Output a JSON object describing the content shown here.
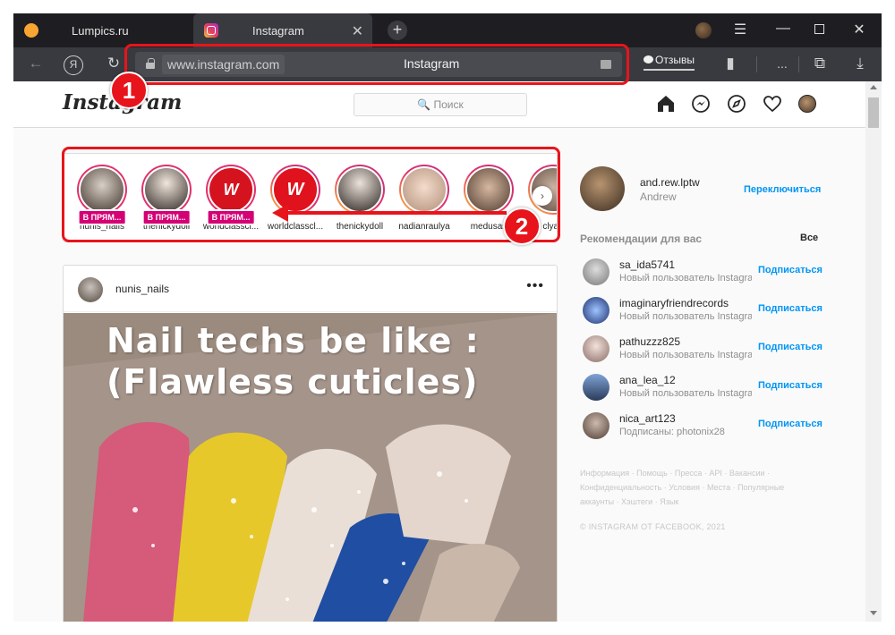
{
  "browser": {
    "tabs": [
      {
        "label": "Lumpics.ru"
      },
      {
        "label": "Instagram",
        "close": "✕"
      }
    ],
    "new_tab": "+",
    "window_controls": {
      "menu": "☰",
      "minimize": "—",
      "close": "✕"
    },
    "address": {
      "url": "www.instagram.com",
      "title": "Instagram"
    },
    "toolbar": {
      "yandex": "Я",
      "reviews_label": "Отзывы",
      "more": "..."
    }
  },
  "instagram": {
    "logo": "Instagram",
    "search_placeholder": "🔍 Поиск",
    "stories": [
      {
        "user": "nunis_nails",
        "live": true,
        "live_label": "В ПРЯМ..."
      },
      {
        "user": "thenickydoll",
        "live": true,
        "live_label": "В ПРЯМ..."
      },
      {
        "user": "worldclasscl...",
        "live": true,
        "live_label": "В ПРЯМ..."
      },
      {
        "user": "worldclasscl...",
        "live": false
      },
      {
        "user": "thenickydoll",
        "live": false
      },
      {
        "user": "nadianraulya",
        "live": false
      },
      {
        "user": "medusas",
        "live": false
      },
      {
        "user": "clyan",
        "live": false
      }
    ],
    "stories_next": "›",
    "post": {
      "username": "nunis_nails",
      "more": "•••",
      "caption_line1": "Nail techs be like :",
      "caption_line2": "(Flawless cuticles)"
    },
    "sidebar": {
      "username": "and.rew.lptw",
      "full_name": "Andrew",
      "switch": "Переключиться",
      "recommendations_title": "Рекомендации для вас",
      "see_all": "Все",
      "suggestions": [
        {
          "name": "sa_ida5741",
          "sub": "Новый пользователь Instagram",
          "action": "Подписаться"
        },
        {
          "name": "imaginaryfriendrecords",
          "sub": "Новый пользователь Instagram",
          "action": "Подписаться"
        },
        {
          "name": "pathuzzz825",
          "sub": "Новый пользователь Instagram",
          "action": "Подписаться"
        },
        {
          "name": "ana_lea_12",
          "sub": "Новый пользователь Instagram",
          "action": "Подписаться"
        },
        {
          "name": "nica_art123",
          "sub": "Подписаны: photonix28",
          "action": "Подписаться"
        }
      ],
      "footer_links": "Информация · Помощь · Пресса · API · Вакансии · Конфиденциальность · Условия · Места · Популярные аккаунты · Хэштеги · Язык",
      "copyright": "© INSTAGRAM ОТ FACEBOOK, 2021"
    }
  },
  "annotations": {
    "marker1": "1",
    "marker2": "2"
  },
  "colors": {
    "accent_red": "#e8141b",
    "ig_blue": "#0095f6",
    "live_badge": "#d40074"
  }
}
